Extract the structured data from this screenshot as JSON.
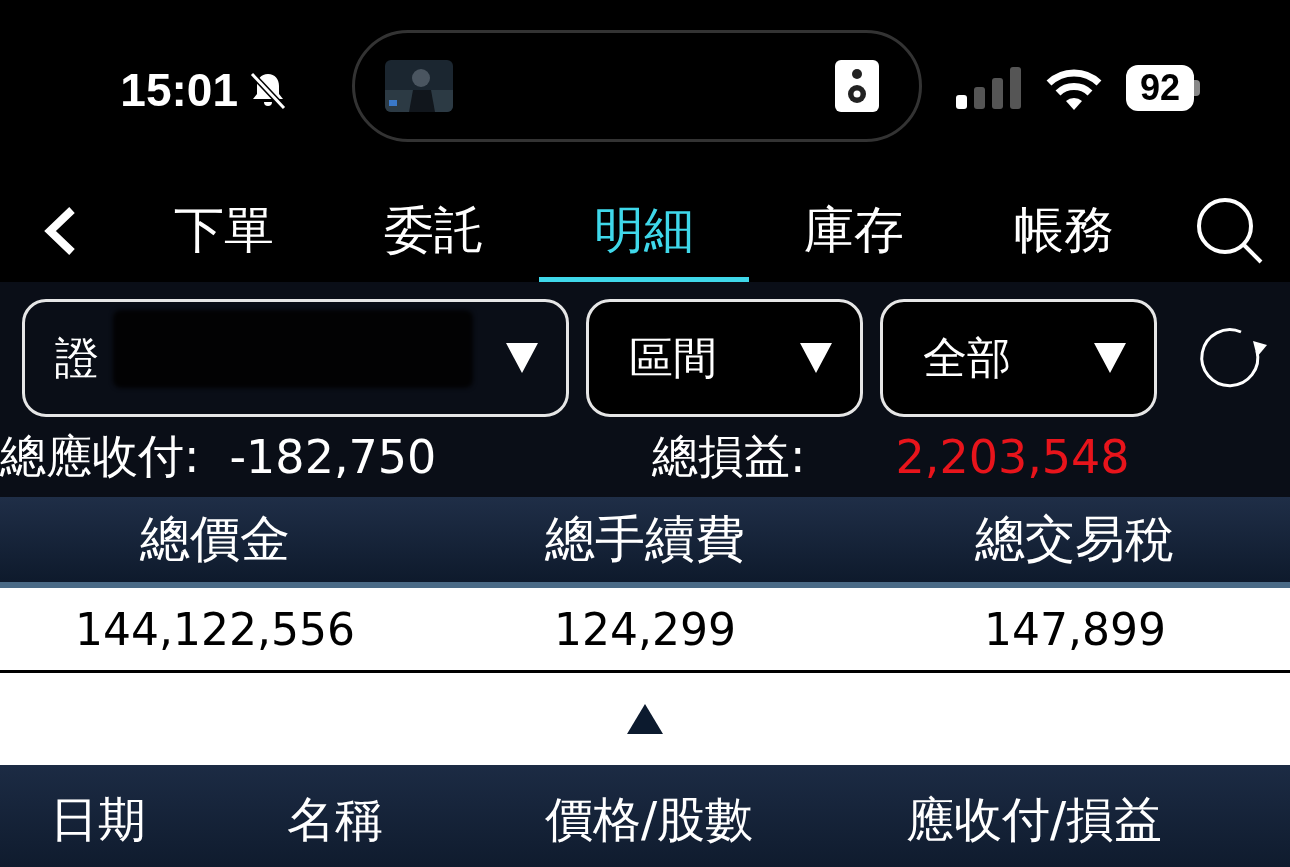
{
  "status_bar": {
    "time": "15:01",
    "silent": true,
    "battery": "92"
  },
  "tabs": [
    {
      "label": "下單",
      "selected": false
    },
    {
      "label": "委託",
      "selected": false
    },
    {
      "label": "明細",
      "selected": true
    },
    {
      "label": "庫存",
      "selected": false
    },
    {
      "label": "帳務",
      "selected": false
    }
  ],
  "filters": [
    {
      "kind": "account",
      "value": "證",
      "redacted": true
    },
    {
      "kind": "select",
      "value": "區間"
    },
    {
      "kind": "select",
      "value": "全部"
    }
  ],
  "summary": [
    {
      "label": "總應收付:",
      "value": "-182,750",
      "color": "#ffffff"
    },
    {
      "label": "總損益:",
      "value": "2,203,548",
      "color": "#e8141b"
    }
  ],
  "totals": {
    "columns": [
      "總價金",
      "總手續費",
      "總交易稅"
    ],
    "values": [
      "144,122,556",
      "124,299",
      "147,899"
    ]
  },
  "list_columns": [
    "日期",
    "名稱",
    "價格/股數",
    "應收付/損益"
  ]
}
